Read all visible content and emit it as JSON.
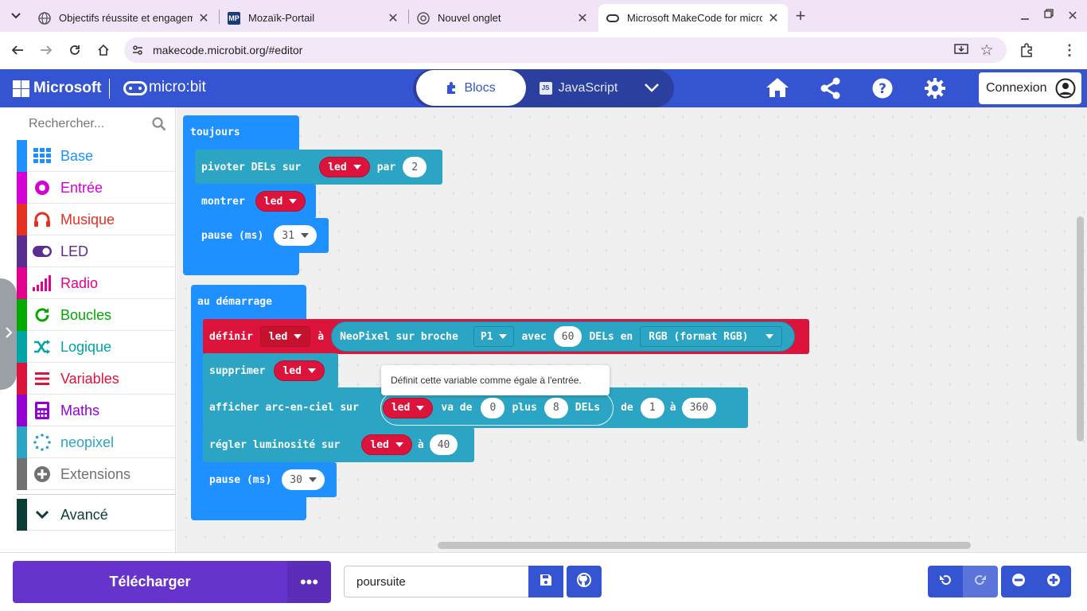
{
  "browser": {
    "tabs": [
      {
        "title": "Objectifs réussite et engageme",
        "favicon": "globe-icon",
        "active": false
      },
      {
        "title": "Mozaïk-Portail",
        "favicon": "mozaik-icon",
        "active": false
      },
      {
        "title": "Nouvel onglet",
        "favicon": "chrome-icon",
        "active": false
      },
      {
        "title": "Microsoft MakeCode for micro",
        "favicon": "makecode-icon",
        "active": true
      }
    ],
    "url": "makecode.microbit.org/#editor",
    "mozaik_badge": "MP"
  },
  "header": {
    "microsoft_label": "Microsoft",
    "product_label": "micro:bit",
    "mode_blocks": "Blocs",
    "mode_js": "JavaScript",
    "js_badge": "JS",
    "signin_label": "Connexion"
  },
  "toolbox": {
    "search_placeholder": "Rechercher...",
    "categories": [
      {
        "label": "Base",
        "color": "#1e90ff",
        "icon": "grid-icon"
      },
      {
        "label": "Entrée",
        "color": "#d400d4",
        "icon": "circle-dot-icon"
      },
      {
        "label": "Musique",
        "color": "#e63022",
        "icon": "headphones-icon"
      },
      {
        "label": "LED",
        "color": "#5c2d91",
        "icon": "toggle-icon"
      },
      {
        "label": "Radio",
        "color": "#e3008c",
        "icon": "signal-bars-icon"
      },
      {
        "label": "Boucles",
        "color": "#00aa00",
        "icon": "refresh-icon"
      },
      {
        "label": "Logique",
        "color": "#00a4a6",
        "icon": "shuffle-icon"
      },
      {
        "label": "Variables",
        "color": "#dc143c",
        "icon": "lines-icon"
      },
      {
        "label": "Maths",
        "color": "#9400d3",
        "icon": "calculator-icon"
      },
      {
        "label": "neopixel",
        "color": "#2ba5c3",
        "icon": "dotted-ring-icon"
      },
      {
        "label": "Extensions",
        "color": "#717171",
        "icon": "plus-circle-icon"
      },
      {
        "label": "Avancé",
        "color": "#0c3c38",
        "icon": "chevron-down-icon"
      }
    ]
  },
  "blocks": {
    "forever": {
      "hat": "toujours",
      "rotate_label": "pivoter DELs sur",
      "rotate_var": "led",
      "rotate_by": "par",
      "rotate_value": "2",
      "show_label": "montrer",
      "show_var": "led",
      "pause_label": "pause (ms)",
      "pause_value": "31"
    },
    "on_start": {
      "hat": "au démarrage",
      "set_label": "définir",
      "set_var": "led",
      "set_to": "à",
      "neo_label": "NeoPixel sur broche",
      "neo_pin": "P1",
      "neo_with": "avec",
      "neo_count": "60",
      "neo_leds_in": "DELs en",
      "neo_mode": "RGB (format RGB)",
      "clear_label": "supprimer",
      "clear_var": "led",
      "rainbow_label": "afficher arc-en-ciel sur",
      "rainbow_var": "led",
      "rainbow_from": "va de",
      "rainbow_start": "0",
      "rainbow_plus": "plus",
      "rainbow_len": "8",
      "rainbow_dels": "DELs",
      "rainbow_de": "de",
      "rainbow_h1": "1",
      "rainbow_to": "à",
      "rainbow_h2": "360",
      "bright_label": "régler luminosité sur",
      "bright_var": "led",
      "bright_to": "à",
      "bright_value": "40",
      "pause_label": "pause (ms)",
      "pause_value": "30"
    }
  },
  "tooltip": "Définit cette variable comme égale à l'entrée.",
  "footer": {
    "download_label": "Télécharger",
    "more_label": "•••",
    "project_name": "poursuite"
  }
}
